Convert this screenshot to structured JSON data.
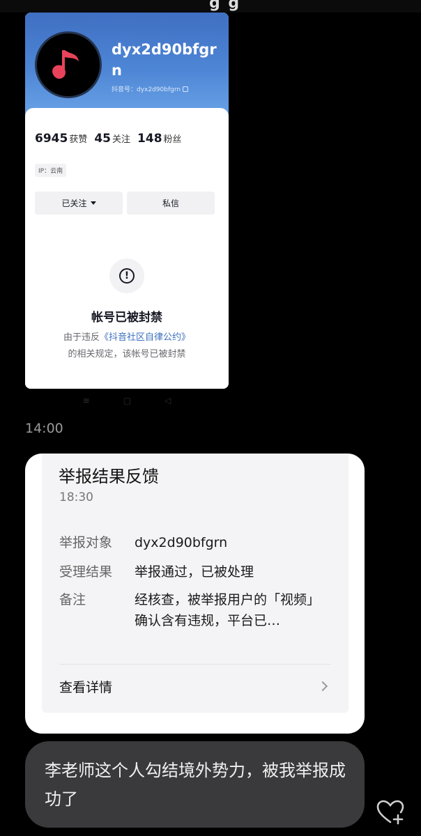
{
  "top_crop_text": "g g",
  "profile": {
    "username": "dyx2d90bfgrn",
    "douyin_id": "抖音号：dyx2d90bfgrn",
    "likes_num": "6945",
    "likes_lbl": "获赞",
    "following_num": "45",
    "following_lbl": "关注",
    "fans_num": "148",
    "fans_lbl": "粉丝",
    "ip": "IP：云南",
    "follow_btn": "已关注",
    "message_btn": "私信",
    "ban_title": "帐号已被封禁",
    "ban_desc_prefix": "由于违反",
    "ban_desc_link": "《抖音社区自律公约》",
    "ban_desc_suffix": "的相关规定，该帐号已被封禁"
  },
  "nav": {
    "menu": "≡",
    "home": "▢",
    "back": "◁"
  },
  "timestamp": "14:00",
  "report": {
    "title": "举报结果反馈",
    "time": "18:30",
    "target_key": "举报对象",
    "target_val": "dyx2d90bfgrn",
    "result_key": "受理结果",
    "result_val": "举报通过，已被处理",
    "note_key": "备注",
    "note_val": "经核查，被举报用户的「视频」确认含有违规，平台已…",
    "detail": "查看详情"
  },
  "message": {
    "text": "李老师这个人勾结境外势力，被我举报成功了"
  },
  "colors": {
    "background": "#000000",
    "header_blue": "#4e86d6",
    "link_blue": "#3b6fbf",
    "bubble": "#3a3a3c",
    "music_red": "#e8435a"
  },
  "icons": [
    "music-note-icon",
    "copy-icon",
    "caret-down-icon",
    "alert-icon",
    "chevron-right-icon",
    "like-add-icon"
  ]
}
